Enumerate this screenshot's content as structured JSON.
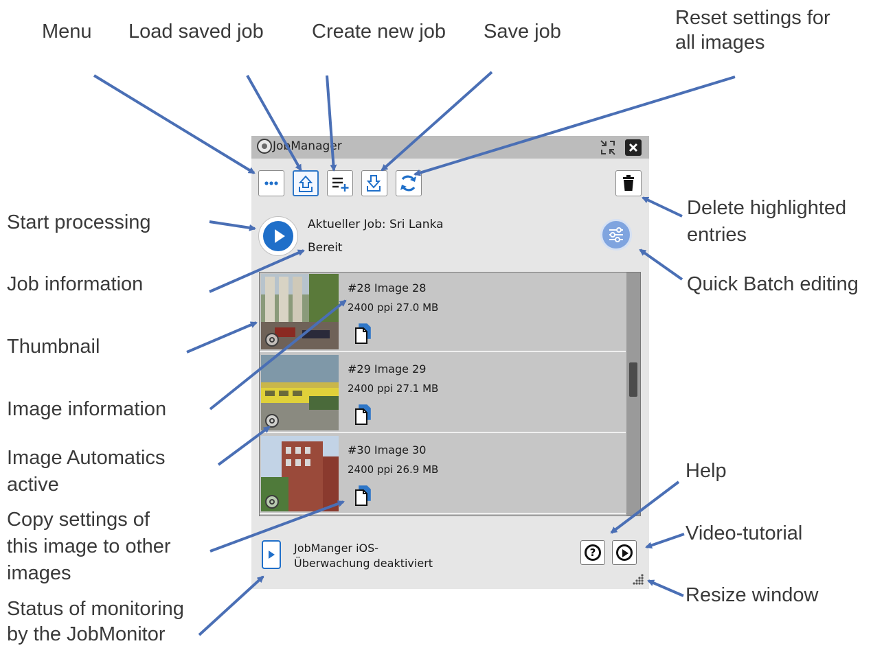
{
  "annotations": {
    "menu": "Menu",
    "load": "Load saved job",
    "create": "Create new job",
    "save": "Save job",
    "reset_line1": "Reset settings for",
    "reset_line2": "all images",
    "start": "Start processing",
    "delete_line1": "Delete highlighted",
    "delete_line2": "entries",
    "job_info": "Job information",
    "quick_batch": "Quick Batch editing",
    "thumbnail": "Thumbnail",
    "image_info": "Image information",
    "automatics_line1": "Image Automatics",
    "automatics_line2": "active",
    "help": "Help",
    "copy_line1": "Copy settings of",
    "copy_line2": "this image to other",
    "copy_line3": "images",
    "video": "Video-tutorial",
    "resize": "Resize window",
    "monitor_line1": "Status of monitoring",
    "monitor_line2": "by the JobMonitor"
  },
  "window": {
    "title": "JobManager",
    "job_title": "Aktueller Job: Sri Lanka",
    "job_status": "Bereit"
  },
  "images": [
    {
      "name": "#28 Image 28",
      "info": "2400 ppi   27.0 MB"
    },
    {
      "name": "#29 Image 29",
      "info": "2400 ppi   27.1 MB"
    },
    {
      "name": "#30 Image 30",
      "info": "2400 ppi   26.9 MB"
    }
  ],
  "footer": {
    "ios_line1": "JobManger iOS-",
    "ios_line2": "Überwachung deaktiviert"
  },
  "colors": {
    "accent": "#1f6fc9",
    "arrow": "#4a6fb5"
  },
  "icons": [
    "menu-icon",
    "upload-icon",
    "add-list-icon",
    "download-icon",
    "refresh-icon",
    "trash-icon",
    "sliders-icon",
    "copy-icon",
    "auto-icon",
    "help-icon",
    "play-icon",
    "resize-icon",
    "phone-icon"
  ]
}
